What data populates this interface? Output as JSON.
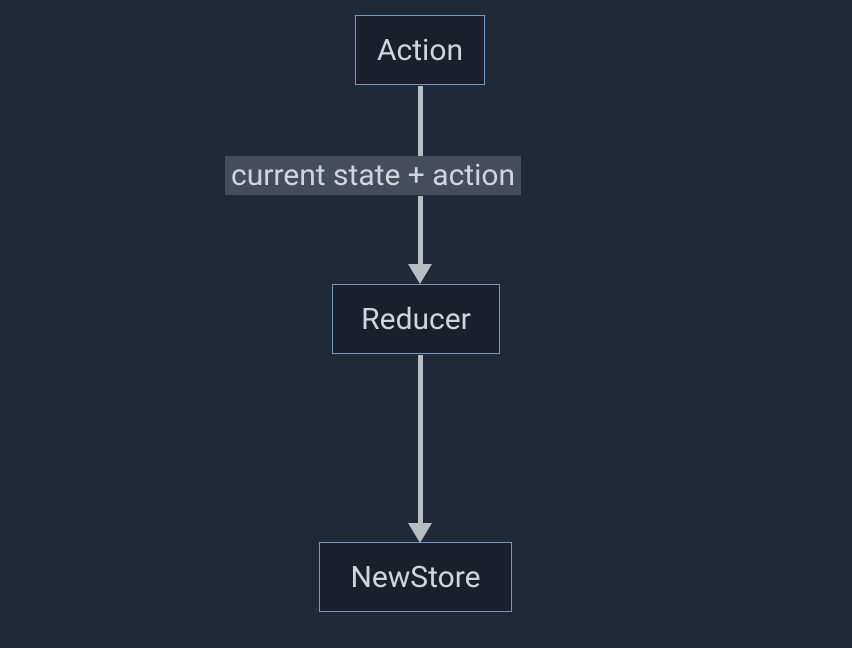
{
  "nodes": {
    "action": {
      "label": "Action"
    },
    "reducer": {
      "label": "Reducer"
    },
    "newstore": {
      "label": "NewStore"
    }
  },
  "edges": {
    "action_to_reducer": {
      "label": "current state + action"
    }
  }
}
